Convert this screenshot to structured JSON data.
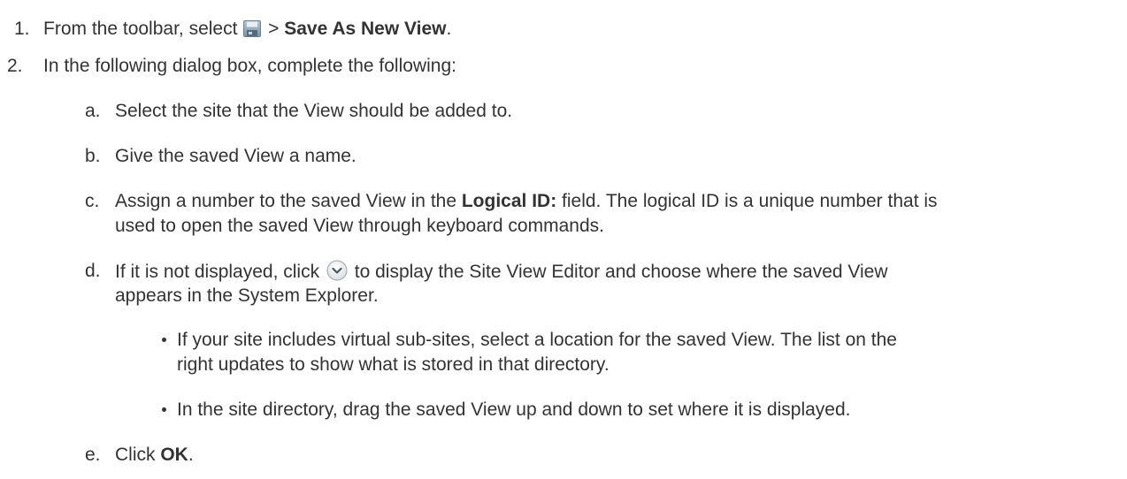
{
  "steps": [
    {
      "marker": "1.",
      "before": "From the toolbar, select ",
      "icon": "save-disk-icon",
      "middle": " > ",
      "bold": "Save As New View",
      "after": "."
    },
    {
      "marker": "2.",
      "text": "In the following dialog box, complete the following:"
    }
  ],
  "substeps": {
    "a": {
      "marker": "a.",
      "text": "Select the site that the View should be added to."
    },
    "b": {
      "marker": "b.",
      "text": "Give the saved View a name."
    },
    "c": {
      "marker": "c.",
      "before": "Assign a number to the saved View in the ",
      "bold": "Logical ID:",
      "after": " field. The logical ID is a unique number that is",
      "line2": "used to open the saved View through keyboard commands."
    },
    "d": {
      "marker": "d.",
      "before": "If it is not displayed, click ",
      "icon": "chevron-down-circle-icon",
      "after": " to display the Site View Editor and choose where the saved View",
      "line2": "appears in the System Explorer."
    },
    "e": {
      "marker": "e.",
      "before": "Click ",
      "bold": "OK",
      "after": "."
    }
  },
  "bullets": [
    {
      "line1": "If your site includes virtual sub-sites, select a location for the saved View. The list on the",
      "line2": "right updates to show what is stored in that directory."
    },
    {
      "line1": "In the site directory, drag the saved View up and down to set where it is displayed."
    }
  ]
}
